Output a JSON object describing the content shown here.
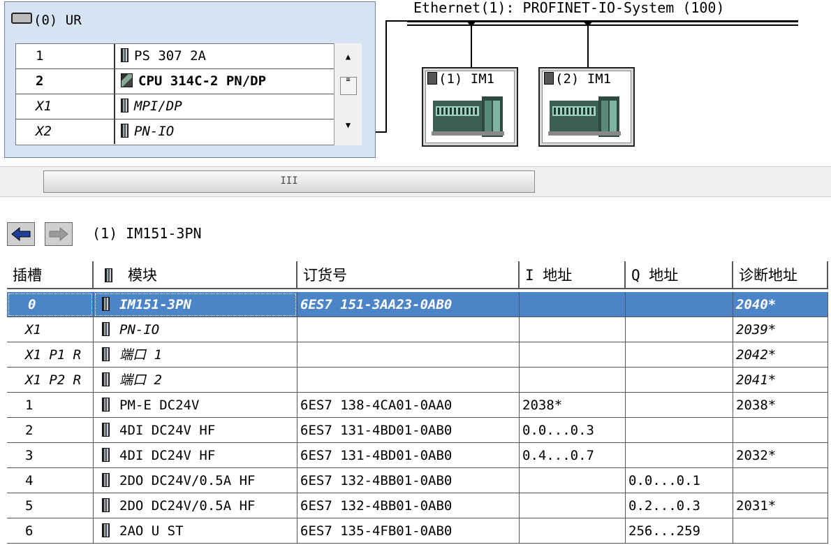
{
  "rack": {
    "title": "(0) UR",
    "rows": [
      {
        "slot": "1",
        "module": "PS 307 2A"
      },
      {
        "slot": "2",
        "module": "CPU 314C-2 PN/DP"
      },
      {
        "slot": "X1",
        "module": "MPI/DP"
      },
      {
        "slot": "X2",
        "module": "PN-IO"
      }
    ]
  },
  "network": {
    "label": "Ethernet(1): PROFINET-IO-System (100)",
    "devices": [
      {
        "label": "(1) IM1"
      },
      {
        "label": "(2) IM1"
      }
    ]
  },
  "scrollbar": {
    "thumb_grip": "III"
  },
  "detail": {
    "title": "(1)   IM151-3PN",
    "columns": [
      "插槽",
      "模块",
      "订货号",
      "I 地址",
      "Q 地址",
      "诊断地址"
    ],
    "rows": [
      {
        "slot": "0",
        "module": "IM151-3PN",
        "order": "6ES7 151-3AA23-0AB0",
        "i_addr": "",
        "q_addr": "",
        "diag": "2040*"
      },
      {
        "slot": "X1",
        "module": "PN-IO",
        "order": "",
        "i_addr": "",
        "q_addr": "",
        "diag": "2039*"
      },
      {
        "slot": "X1 P1 R",
        "module": "端口 1",
        "order": "",
        "i_addr": "",
        "q_addr": "",
        "diag": "2042*"
      },
      {
        "slot": "X1 P2 R",
        "module": "端口 2",
        "order": "",
        "i_addr": "",
        "q_addr": "",
        "diag": "2041*"
      },
      {
        "slot": "1",
        "module": "PM-E DC24V",
        "order": "6ES7 138-4CA01-0AA0",
        "i_addr": "2038*",
        "q_addr": "",
        "diag": "2038*"
      },
      {
        "slot": "2",
        "module": "4DI DC24V HF",
        "order": "6ES7 131-4BD01-0AB0",
        "i_addr": "0.0...0.3",
        "q_addr": "",
        "diag": ""
      },
      {
        "slot": "3",
        "module": "4DI DC24V HF",
        "order": "6ES7 131-4BD01-0AB0",
        "i_addr": "0.4...0.7",
        "q_addr": "",
        "diag": "2032*"
      },
      {
        "slot": "4",
        "module": "2DO DC24V/0.5A HF",
        "order": "6ES7 132-4BB01-0AB0",
        "i_addr": "",
        "q_addr": "0.0...0.1",
        "diag": ""
      },
      {
        "slot": "5",
        "module": "2DO DC24V/0.5A HF",
        "order": "6ES7 132-4BB01-0AB0",
        "i_addr": "",
        "q_addr": "0.2...0.3",
        "diag": "2031*"
      },
      {
        "slot": "6",
        "module": "2AO U ST",
        "order": "6ES7 135-4FB01-0AB0",
        "i_addr": "",
        "q_addr": "256...259",
        "diag": ""
      }
    ]
  }
}
